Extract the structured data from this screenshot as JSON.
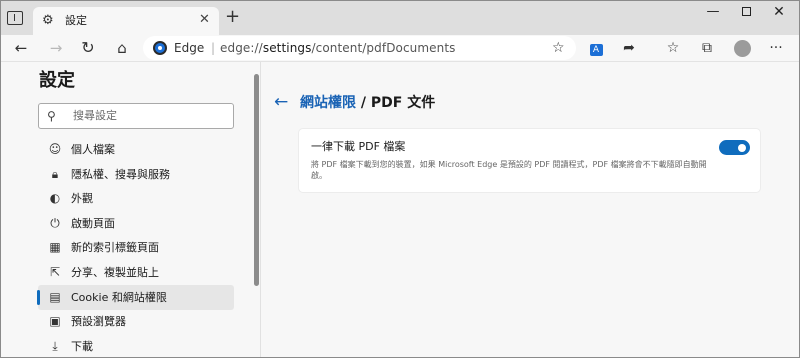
{
  "tab": {
    "title": "設定",
    "close": "✕"
  },
  "newtab": "+",
  "window": {
    "minimize": "—",
    "close": "✕"
  },
  "nav": {
    "back": "←",
    "forward": "→",
    "refresh": "↻",
    "home": "⌂"
  },
  "address": {
    "brand": "Edge",
    "separator": "|",
    "url_prefix": "edge://",
    "url_main": "settings",
    "url_rest": "/content/pdfDocuments"
  },
  "toolbar_icons": {
    "favorite_add": "☆",
    "translate": "A",
    "share": "➦",
    "favorites": "☆",
    "collections": "⧉",
    "more": "···"
  },
  "sidebar": {
    "title": "設定",
    "search_placeholder": "搜尋設定",
    "items": [
      {
        "label": "個人檔案",
        "icon": "profile-icon",
        "glyph": "☺"
      },
      {
        "label": "隱私權、搜尋與服務",
        "icon": "lock-icon",
        "glyph": "🔒︎"
      },
      {
        "label": "外觀",
        "icon": "appearance-icon",
        "glyph": "◐"
      },
      {
        "label": "啟動頁面",
        "icon": "power-icon",
        "glyph": "⏻"
      },
      {
        "label": "新的索引標籤頁面",
        "icon": "new-tab-icon",
        "glyph": "▦"
      },
      {
        "label": "分享、複製並貼上",
        "icon": "share-icon",
        "glyph": "⇱"
      },
      {
        "label": "Cookie 和網站權限",
        "icon": "site-permissions-icon",
        "glyph": "▤"
      },
      {
        "label": "預設瀏覽器",
        "icon": "default-browser-icon",
        "glyph": "▣"
      },
      {
        "label": "下載",
        "icon": "download-icon",
        "glyph": "⤓"
      }
    ],
    "selected_index": 6
  },
  "main": {
    "back_glyph": "←",
    "breadcrumb": {
      "parent": "網站權限",
      "separator": " / ",
      "current": "PDF 文件"
    },
    "card": {
      "title": "一律下載 PDF 檔案",
      "description": "將 PDF 檔案下載到您的裝置，如果 Microsoft Edge 是預設的 PDF 閱讀程式，PDF 檔案將會不下載隨即自動開啟。",
      "toggle_on": true
    }
  },
  "colors": {
    "accent": "#0f6cbd",
    "link": "#1a63b5"
  }
}
